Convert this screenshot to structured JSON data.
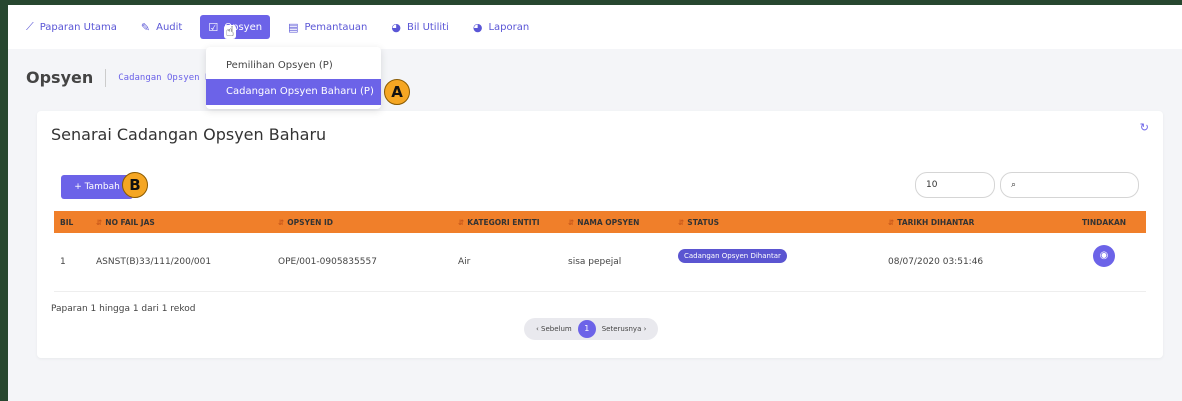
{
  "nav": {
    "items": [
      {
        "label": "Paparan Utama",
        "icon": "chart-line-icon",
        "glyph": "📈"
      },
      {
        "label": "Audit",
        "icon": "edit-icon",
        "glyph": "✎"
      },
      {
        "label": "Opsyen",
        "icon": "checklist-icon",
        "glyph": "☑"
      },
      {
        "label": "Pemantauan",
        "icon": "document-icon",
        "glyph": "▤"
      },
      {
        "label": "Bil Utiliti",
        "icon": "pie-chart-icon",
        "glyph": "◕"
      },
      {
        "label": "Laporan",
        "icon": "pie-chart-icon",
        "glyph": "◕"
      }
    ],
    "active_index": 2
  },
  "dropdown": {
    "items": [
      "Pemilihan Opsyen (P)",
      "Cadangan Opsyen Baharu (P)"
    ],
    "selected_index": 1
  },
  "badges": {
    "a": "A",
    "b": "B"
  },
  "page": {
    "title": "Opsyen",
    "breadcrumb": "Cadangan Opsyen B"
  },
  "card": {
    "title": "Senarai Cadangan Opsyen Baharu",
    "refresh_icon": "↻",
    "add_label": "+ Tambah",
    "perpage_value": "10",
    "search_icon": "⌕",
    "search_placeholder": ""
  },
  "table": {
    "columns": [
      "BIL",
      "NO FAIL JAS",
      "OPSYEN ID",
      "KATEGORI ENTITI",
      "NAMA OPSYEN",
      "STATUS",
      "TARIKH DIHANTAR",
      "TINDAKAN"
    ],
    "rows": [
      {
        "bil": "1",
        "no_fail": "ASNST(B)33/111/200/001",
        "opsyen_id": "OPE/001-0905835557",
        "kategori": "Air",
        "nama": "sisa pepejal",
        "status": "Cadangan Opsyen Dihantar",
        "tarikh": "08/07/2020 03:51:46",
        "action_icon": "👁"
      }
    ]
  },
  "footer": {
    "info": "Paparan 1 hingga 1 dari 1 rekod",
    "prev": "‹ Sebelum",
    "current": "1",
    "next": "Seterusnya ›"
  },
  "colors": {
    "accent": "#6c63e8",
    "table_header": "#f07f2a",
    "badge": "#f5a623",
    "frame": "#27472f"
  }
}
